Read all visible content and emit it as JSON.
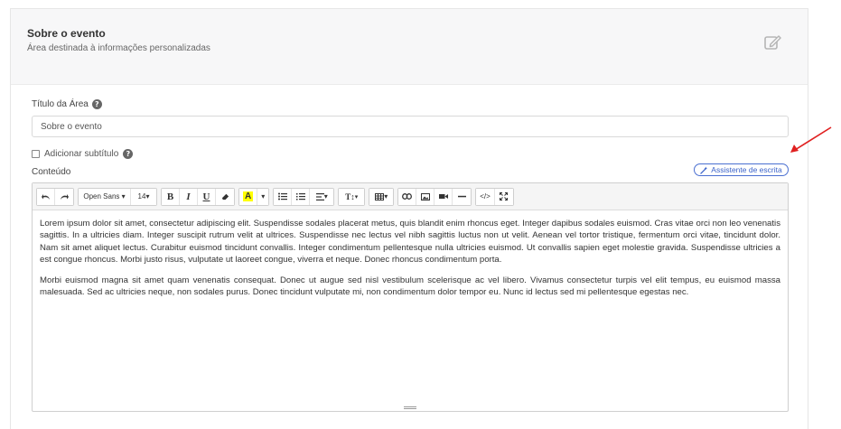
{
  "section": {
    "title": "Sobre o evento",
    "subtitle": "Área destinada à informações personalizadas"
  },
  "form": {
    "title_label": "Título da Área",
    "title_value": "Sobre o evento",
    "subtitle_checkbox_label": "Adicionar subtítulo",
    "content_label": "Conteúdo",
    "assistant_label": "Assistente de escrita"
  },
  "toolbar": {
    "font_family": "Open Sans",
    "font_size": "14",
    "bold": "B",
    "italic": "I",
    "underline": "U",
    "highlight": "A",
    "text_size": "T↕"
  },
  "editor": {
    "paragraph1": "Lorem ipsum dolor sit amet, consectetur adipiscing elit. Suspendisse sodales placerat metus, quis blandit enim rhoncus eget. Integer dapibus sodales euismod. Cras vitae orci non leo venenatis sagittis. In a ultricies diam. Integer suscipit rutrum velit at ultrices. Suspendisse nec lectus vel nibh sagittis luctus non ut velit. Aenean vel tortor tristique, fermentum orci vitae, tincidunt dolor. Nam sit amet aliquet lectus. Curabitur euismod tincidunt convallis. Integer condimentum pellentesque nulla ultricies euismod. Ut convallis sapien eget molestie gravida. Suspendisse ultricies a est congue rhoncus. Morbi justo risus, vulputate ut laoreet congue, viverra et neque. Donec rhoncus condimentum porta.",
    "paragraph2": "Morbi euismod magna sit amet quam venenatis consequat. Donec ut augue sed nisl vestibulum scelerisque ac vel libero. Vivamus consectetur turpis vel elit tempus, eu euismod massa malesuada. Sed ac ultricies neque, non sodales purus. Donec tincidunt vulputate mi, non condimentum dolor tempor eu. Nunc id lectus sed mi pellentesque egestas nec."
  },
  "colors": {
    "accent": "#3a62c9",
    "arrow": "#e02020",
    "header_bg": "#f7f7f8",
    "highlight": "#ffff00"
  }
}
